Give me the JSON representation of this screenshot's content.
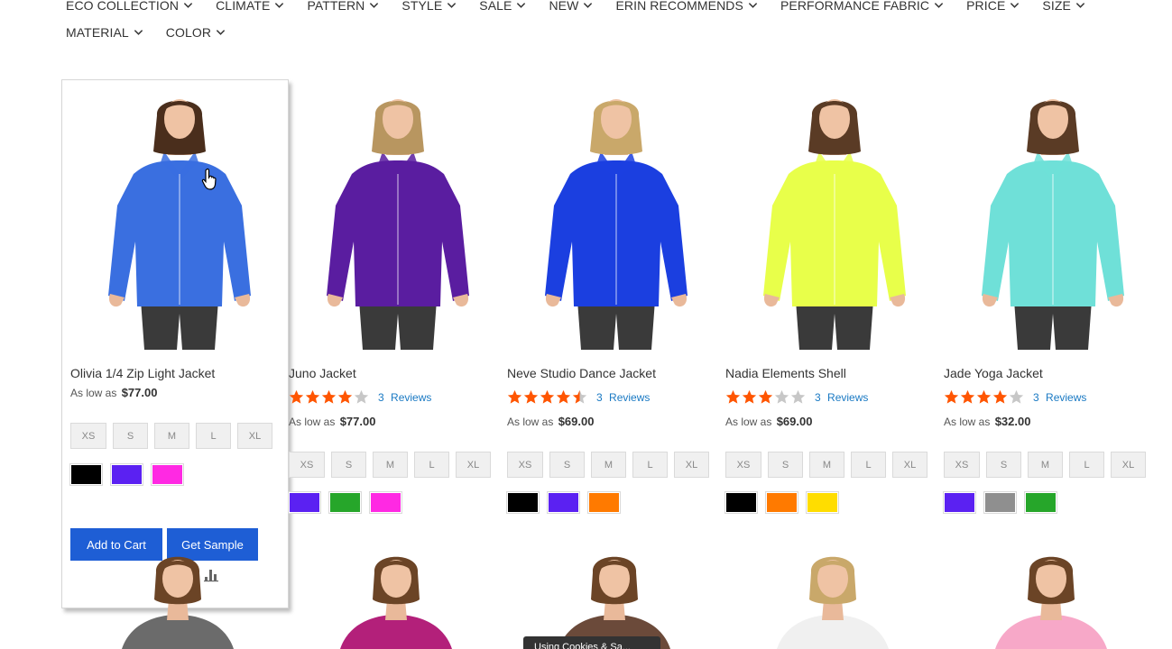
{
  "filters": {
    "row1": [
      "ECO COLLECTION",
      "CLIMATE",
      "PATTERN",
      "STYLE",
      "SALE",
      "NEW",
      "ERIN RECOMMENDS",
      "PERFORMANCE FABRIC",
      "PRICE",
      "SIZE"
    ],
    "row2": [
      "MATERIAL",
      "COLOR"
    ]
  },
  "products": [
    {
      "name": "Olivia 1/4 Zip Light Jacket",
      "price_prefix": "As low as",
      "price": "$77.00",
      "sizes": [
        "XS",
        "S",
        "M",
        "L",
        "XL"
      ],
      "colors": [
        "#000000",
        "#5b21f2",
        "#ff29e3"
      ],
      "jacket_color": "#3a6fe0",
      "add_to_cart": "Add to Cart",
      "get_sample": "Get Sample"
    },
    {
      "name": "Juno Jacket",
      "rating": 4,
      "review_count": "3",
      "reviews_label": "Reviews",
      "price_prefix": "As low as",
      "price": "$77.00",
      "sizes": [
        "XS",
        "S",
        "M",
        "L",
        "XL"
      ],
      "colors": [
        "#5b21f2",
        "#26a62a",
        "#ff29e3"
      ],
      "jacket_color": "#5a1da0"
    },
    {
      "name": "Neve Studio Dance Jacket",
      "rating": 4.5,
      "review_count": "3",
      "reviews_label": "Reviews",
      "price_prefix": "As low as",
      "price": "$69.00",
      "sizes": [
        "XS",
        "S",
        "M",
        "L",
        "XL"
      ],
      "colors": [
        "#000000",
        "#5b21f2",
        "#ff7a00"
      ],
      "jacket_color": "#1b3fe0"
    },
    {
      "name": "Nadia Elements Shell",
      "rating": 3,
      "review_count": "3",
      "reviews_label": "Reviews",
      "price_prefix": "As low as",
      "price": "$69.00",
      "sizes": [
        "XS",
        "S",
        "M",
        "L",
        "XL"
      ],
      "colors": [
        "#000000",
        "#ff7a00",
        "#ffdd00"
      ],
      "jacket_color": "#e8ff4a"
    },
    {
      "name": "Jade Yoga Jacket",
      "rating": 4,
      "review_count": "3",
      "reviews_label": "Reviews",
      "price_prefix": "As low as",
      "price": "$32.00",
      "sizes": [
        "XS",
        "S",
        "M",
        "L",
        "XL"
      ],
      "colors": [
        "#5b21f2",
        "#8f8f8f",
        "#26a62a"
      ],
      "jacket_color": "#6fe0d8"
    }
  ],
  "second_row_colors": [
    "#6b6b6b",
    "#b3207a",
    "#6b4a3a",
    "#f0f0f0",
    "#f7a8c8"
  ],
  "tooltip": "Using Cookies & Sa..."
}
